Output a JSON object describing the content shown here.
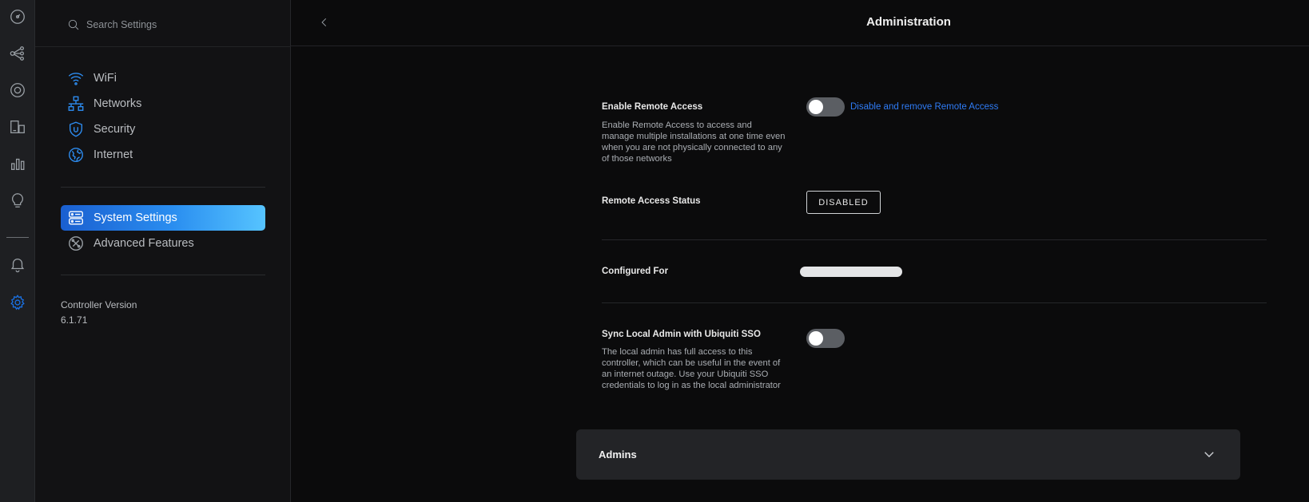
{
  "rail": {
    "icons": [
      "dashboard-icon",
      "topology-icon",
      "devices-icon",
      "clients-icon",
      "statistics-icon",
      "insights-icon",
      "alerts-icon",
      "settings-icon"
    ]
  },
  "sidebar": {
    "search_placeholder": "Search Settings",
    "nav_groups": [
      {
        "label": "WiFi",
        "icon": "wifi-icon"
      },
      {
        "label": "Networks",
        "icon": "networks-icon"
      },
      {
        "label": "Security",
        "icon": "shield-icon"
      },
      {
        "label": "Internet",
        "icon": "globe-icon"
      }
    ],
    "system": {
      "label": "System Settings",
      "icon": "server-icon"
    },
    "advanced": {
      "label": "Advanced Features",
      "icon": "tools-icon"
    },
    "version_label": "Controller Version",
    "version_value": "6.1.71"
  },
  "header": {
    "title": "Administration"
  },
  "remote_access": {
    "label": "Enable Remote Access",
    "description": "Enable Remote Access to access and manage multiple installations at one time even when you are not physically connected to any of those networks",
    "enabled": false,
    "link": "Disable and remove Remote Access"
  },
  "remote_status": {
    "label": "Remote Access Status",
    "value": "DISABLED"
  },
  "configured_for": {
    "label": "Configured For"
  },
  "sync_sso": {
    "label": "Sync Local Admin with Ubiquiti SSO",
    "description": "The local admin has full access to this controller, which can be useful in the event of an internet outage. Use your Ubiquiti SSO credentials to log in as the local administrator",
    "enabled": false
  },
  "admins": {
    "label": "Admins"
  }
}
